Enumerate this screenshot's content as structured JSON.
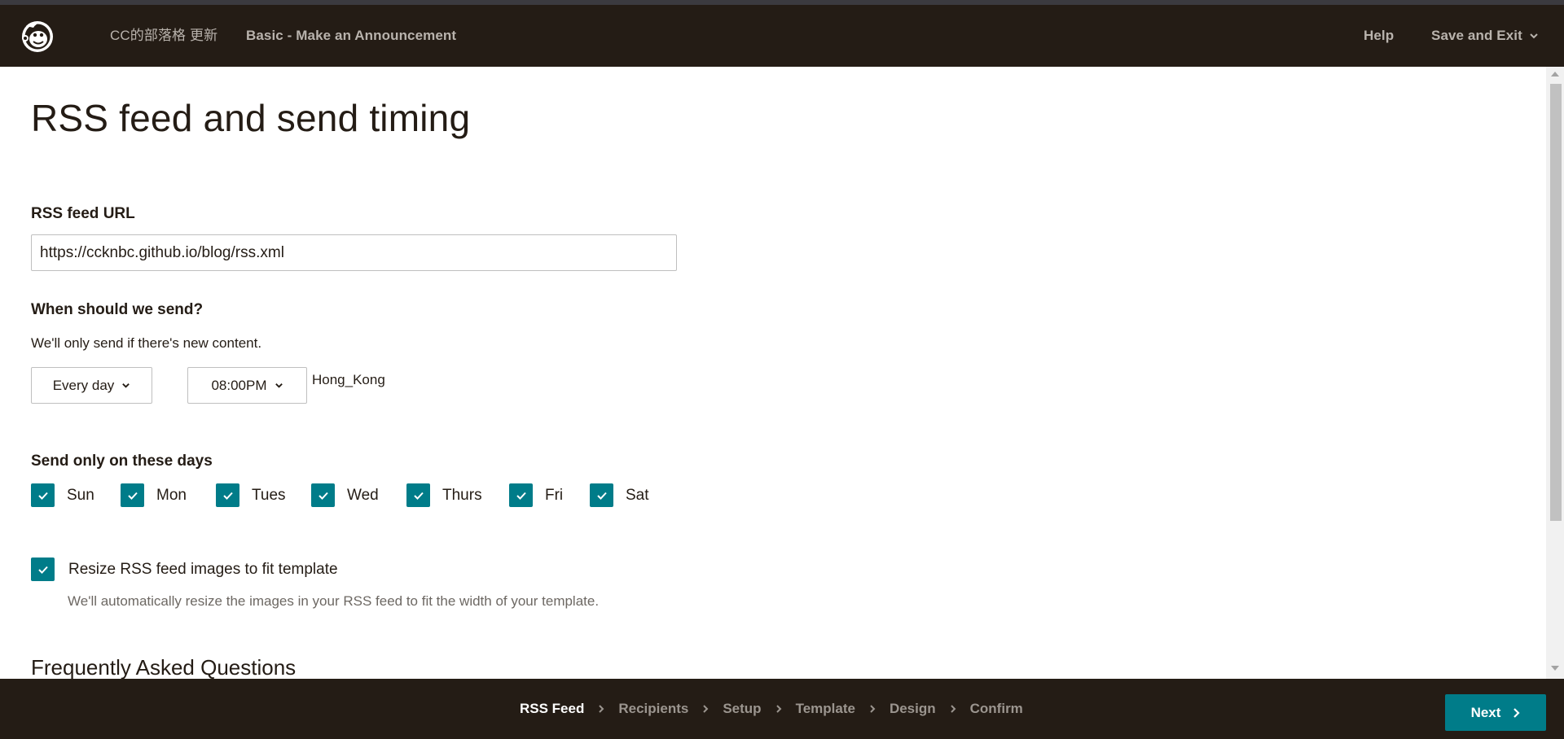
{
  "header": {
    "campaign_name": "CC的部落格 更新",
    "campaign_type": "Basic - Make an Announcement",
    "help_label": "Help",
    "save_exit_label": "Save and Exit"
  },
  "page": {
    "title": "RSS feed and send timing"
  },
  "rss": {
    "label": "RSS feed URL",
    "url_value": "https://ccknbc.github.io/blog/rss.xml"
  },
  "timing": {
    "label": "When should we send?",
    "subtext": "We'll only send if there's new content.",
    "frequency": "Every day",
    "time": "08:00PM",
    "timezone": "Hong_Kong"
  },
  "days": {
    "label": "Send only on these days",
    "items": [
      {
        "label": "Sun",
        "checked": true
      },
      {
        "label": "Mon",
        "checked": true
      },
      {
        "label": "Tues",
        "checked": true
      },
      {
        "label": "Wed",
        "checked": true
      },
      {
        "label": "Thurs",
        "checked": true
      },
      {
        "label": "Fri",
        "checked": true
      },
      {
        "label": "Sat",
        "checked": true
      }
    ]
  },
  "resize": {
    "label": "Resize RSS feed images to fit template",
    "checked": true,
    "help": "We'll automatically resize the images in your RSS feed to fit the width of your template."
  },
  "faq": {
    "title": "Frequently Asked Questions"
  },
  "footer": {
    "steps": [
      "RSS Feed",
      "Recipients",
      "Setup",
      "Template",
      "Design",
      "Confirm"
    ],
    "active_step": "RSS Feed",
    "next_label": "Next"
  },
  "colors": {
    "header_bg": "#241c15",
    "accent": "#007c89",
    "text": "#241c15"
  }
}
